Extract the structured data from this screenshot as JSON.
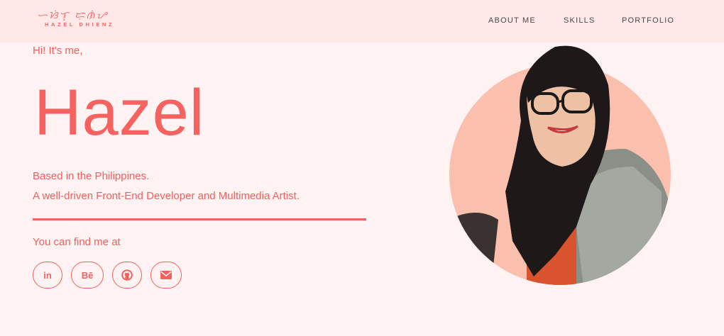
{
  "brand": {
    "script_text": "ᜑᜐᜒᜎ᜔ ᜇᜓᜈᜒᜌ",
    "name_text": "HAZEL DHIENZ",
    "accent": "#f0605f"
  },
  "nav": {
    "items": [
      {
        "label": "ABOUT ME"
      },
      {
        "label": "SKILLS"
      },
      {
        "label": "PORTFOLIO"
      }
    ]
  },
  "hero": {
    "greeting": "Hi! It's me,",
    "name": "Hazel",
    "bio_line1": "Based in the Philippines.",
    "bio_line2": "A well-driven Front-End Developer and Multimedia Artist.",
    "find_me": "You can find me at"
  },
  "social": {
    "items": [
      {
        "label": "in",
        "icon": "linkedin-icon"
      },
      {
        "label": "Bē",
        "icon": "behance-icon"
      },
      {
        "label": "",
        "icon": "github-icon"
      },
      {
        "label": "",
        "icon": "envelope-icon"
      }
    ]
  },
  "colors": {
    "background": "#fff2f2",
    "navbar": "#ffe8e8",
    "accent": "#f0605f",
    "portrait_circle": "#fbbfae"
  }
}
